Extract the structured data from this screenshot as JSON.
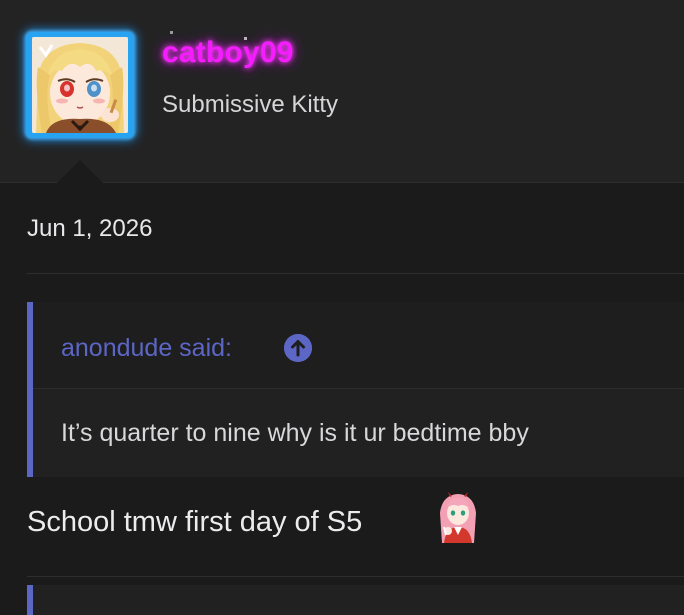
{
  "user": {
    "username": "catboy09",
    "title": "Submissive Kitty",
    "username_color": "#f51cff",
    "avatar_frame_color": "#27a3f2"
  },
  "post": {
    "date": "Jun 1, 2026",
    "quote": {
      "author_label": "anondude said:",
      "body": "It’s quarter to nine why is it ur bedtime bby",
      "accent_color": "#5c66c4",
      "jump_icon": "arrow-up-circle-icon"
    },
    "reply_text": "School tmw first day of S5",
    "smilie_icon": "anime-girl-sticker-icon"
  }
}
